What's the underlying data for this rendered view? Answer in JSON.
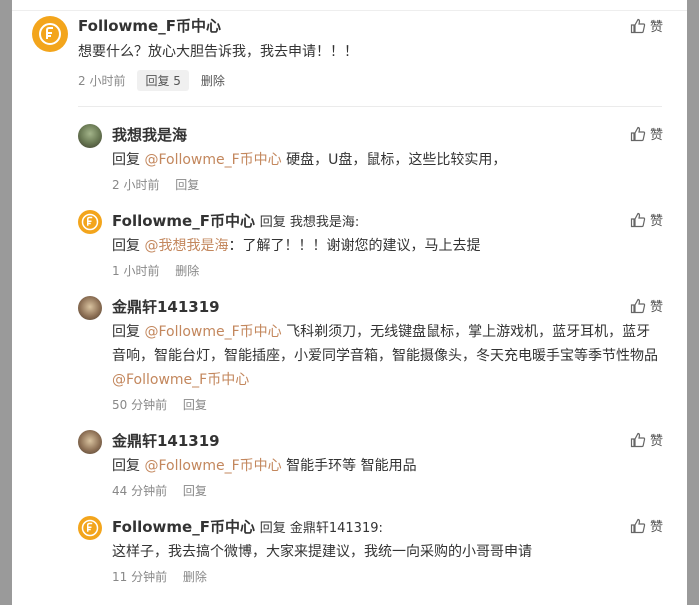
{
  "main_comment": {
    "author": "Followme_F币中心",
    "text": "想要什么？放心大胆告诉我，我去申请！！！",
    "time": "2 小时前",
    "reply_label": "回复 5",
    "delete_label": "删除",
    "like_label": "赞"
  },
  "replies": [
    {
      "author": "我想我是海",
      "reply_to": "",
      "prefix": "回复 ",
      "mention": "@Followme_F币中心",
      "text": " 硬盘，U盘，鼠标，这些比较实用，",
      "time": "2 小时前",
      "action": "回复",
      "like_label": "赞"
    },
    {
      "author": "Followme_F币中心",
      "reply_to": "回复 我想我是海:",
      "prefix": "回复 ",
      "mention": "@我想我是海",
      "text": "：了解了！！！谢谢您的建议，马上去提",
      "time": "1 小时前",
      "action": "删除",
      "like_label": "赞"
    },
    {
      "author": "金鼎轩141319",
      "reply_to": "",
      "prefix": "回复 ",
      "mention": "@Followme_F币中心",
      "text": " 飞科剃须刀，无线键盘鼠标，掌上游戏机，蓝牙耳机，蓝牙音响，智能台灯，智能插座，小爱同学音箱，智能摄像头，冬天充电暖手宝等季节性物品",
      "mention_end": "@Followme_F币中心",
      "time": "50 分钟前",
      "action": "回复",
      "like_label": "赞"
    },
    {
      "author": "金鼎轩141319",
      "reply_to": "",
      "prefix": "回复 ",
      "mention": "@Followme_F币中心",
      "text": " 智能手环等 智能用品",
      "time": "44 分钟前",
      "action": "回复",
      "like_label": "赞"
    },
    {
      "author": "Followme_F币中心",
      "reply_to": "回复 金鼎轩141319:",
      "prefix": "",
      "mention": "",
      "text": "这样子，我去搞个微博，大家来提建议，我统一向采购的小哥哥申请",
      "time": "11 分钟前",
      "action": "删除",
      "like_label": "赞"
    }
  ],
  "colors": {
    "mention": "#c3875d",
    "logo": "#f3a51c"
  },
  "icons": {
    "like": "thumbs-up-icon",
    "logo": "f-coin-logo-icon"
  }
}
